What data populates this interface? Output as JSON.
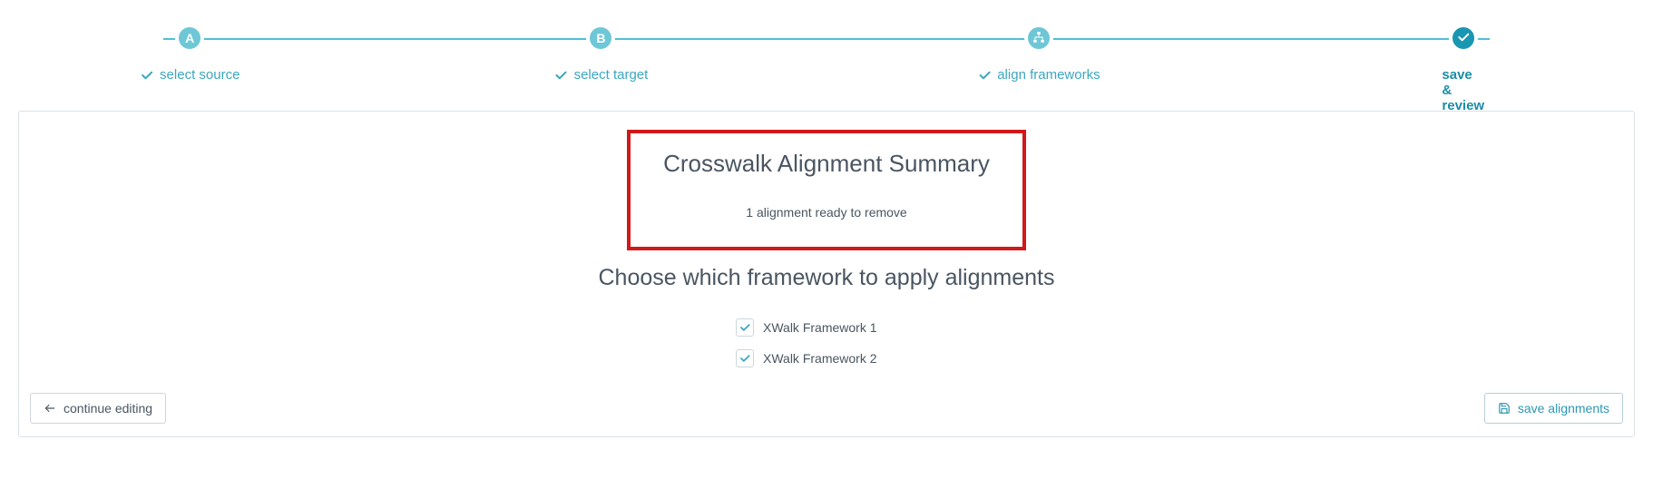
{
  "stepper": {
    "steps": [
      {
        "badge": "A",
        "label": "select source",
        "completed": true,
        "active": false
      },
      {
        "badge": "B",
        "label": "select target",
        "completed": true,
        "active": false
      },
      {
        "badge": "icon",
        "label": "align frameworks",
        "completed": true,
        "active": false
      },
      {
        "badge": "✓",
        "label": "save & review",
        "completed": false,
        "active": true
      }
    ]
  },
  "summary": {
    "title": "Crosswalk Alignment Summary",
    "subtitle": "1 alignment ready to remove"
  },
  "choose": {
    "title": "Choose which framework to apply alignments"
  },
  "frameworks": [
    {
      "label": "XWalk Framework 1",
      "checked": true
    },
    {
      "label": "XWalk Framework 2",
      "checked": true
    }
  ],
  "buttons": {
    "continue": "continue editing",
    "save": "save alignments"
  }
}
